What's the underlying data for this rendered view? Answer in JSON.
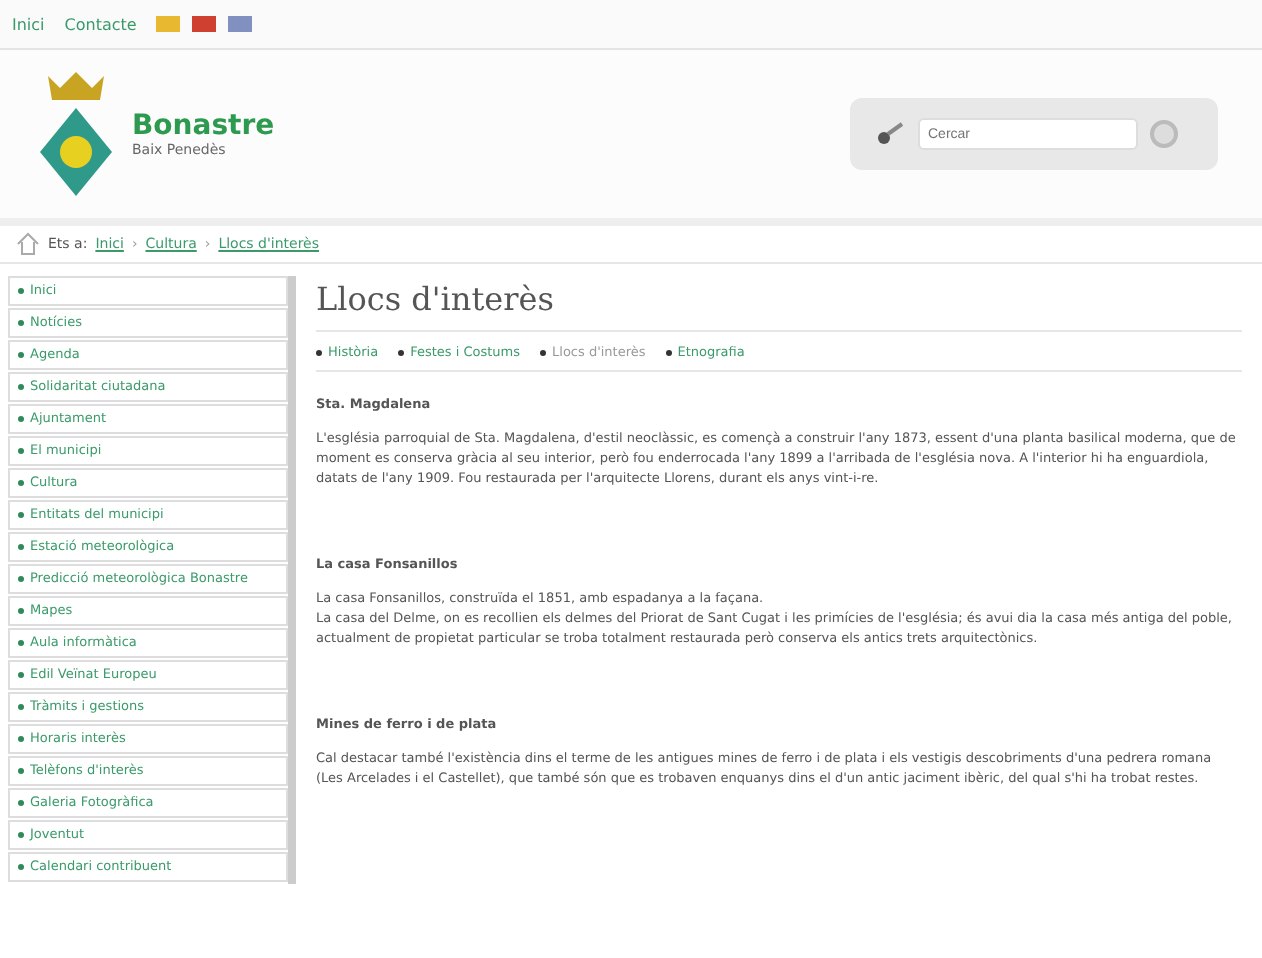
{
  "top_links": [
    "Inici",
    "Contacte"
  ],
  "languages": [
    {
      "color": "#e8b830"
    },
    {
      "color": "#d04030"
    },
    {
      "color": "#8090c0"
    }
  ],
  "site": {
    "name": "Bonastre",
    "subtitle": "Baix Penedès"
  },
  "search": {
    "placeholder": "Cercar"
  },
  "breadcrumb": {
    "prefix": "Ets a:",
    "separator": "›",
    "items": [
      "Inici",
      "Cultura",
      "Llocs d'interès"
    ]
  },
  "sidebar": {
    "items": [
      "Inici",
      "Notícies",
      "Agenda",
      "Solidaritat ciutadana",
      "Ajuntament",
      "El municipi",
      "Cultura",
      "Entitats del municipi",
      "Estació meteorològica",
      "Predicció meteorològica Bonastre",
      "Mapes",
      "Aula informàtica",
      "Edil Veïnat Europeu",
      "Tràmits i gestions",
      "Horaris interès",
      "Telèfons d'interès",
      "Galeria Fotogràfica",
      "Joventut",
      "Calendari contribuent"
    ]
  },
  "page": {
    "title": "Llocs d'interès",
    "subnav": [
      {
        "label": "Història",
        "selected": false
      },
      {
        "label": "Festes i Costums",
        "selected": false
      },
      {
        "label": "Llocs d'interès",
        "selected": true
      },
      {
        "label": "Etnografia",
        "selected": false
      }
    ],
    "sections": [
      {
        "heading": "Sta. Magdalena",
        "paragraphs": [
          "L'església parroquial de Sta. Magdalena, d'estil neoclàssic, es començà a construir l'any 1873, essent d'una planta basilical moderna, que de moment es conserva gràcia al seu interior, però fou enderrocada l'any 1899 a l'arribada de l'església nova. A l'interior hi ha enguardiola, datats de l'any 1909. Fou restaurada per l'arquitecte Llorens, durant els anys vint-i-re."
        ]
      },
      {
        "heading": "La casa Fonsanillos",
        "paragraphs": [
          "La casa Fonsanillos, construïda el 1851, amb espadanya a la façana.",
          "La casa del Delme, on es recollien els delmes del Priorat de Sant Cugat i les primícies de l'església; és avui dia la casa més antiga del poble, actualment de propietat particular se troba totalment restaurada però conserva els antics trets arquitectònics."
        ]
      },
      {
        "heading": "Mines de ferro i de plata",
        "paragraphs": [
          "Cal destacar també l'existència dins el terme de les antigues mines de ferro i de plata i els vestigis descobriments d'una pedrera romana (Les Arcelades i el Castellet), que també són que es trobaven enquanys dins el d'un antic jaciment ibèric, del qual s'hi ha trobat restes."
        ]
      }
    ]
  }
}
